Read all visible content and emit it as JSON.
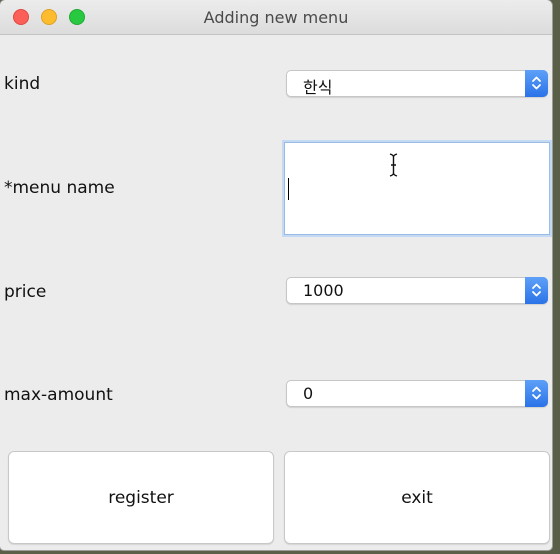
{
  "window": {
    "title": "Adding new menu"
  },
  "form": {
    "kind": {
      "label": "kind",
      "value": "한식"
    },
    "menu_name": {
      "label": "*menu name",
      "value": ""
    },
    "price": {
      "label": "price",
      "value": "1000"
    },
    "max_amount": {
      "label": "max-amount",
      "value": "0"
    }
  },
  "buttons": {
    "register": "register",
    "exit": "exit"
  },
  "colors": {
    "accent": "#2a73e8",
    "focus_ring": "#9bbbe4"
  }
}
